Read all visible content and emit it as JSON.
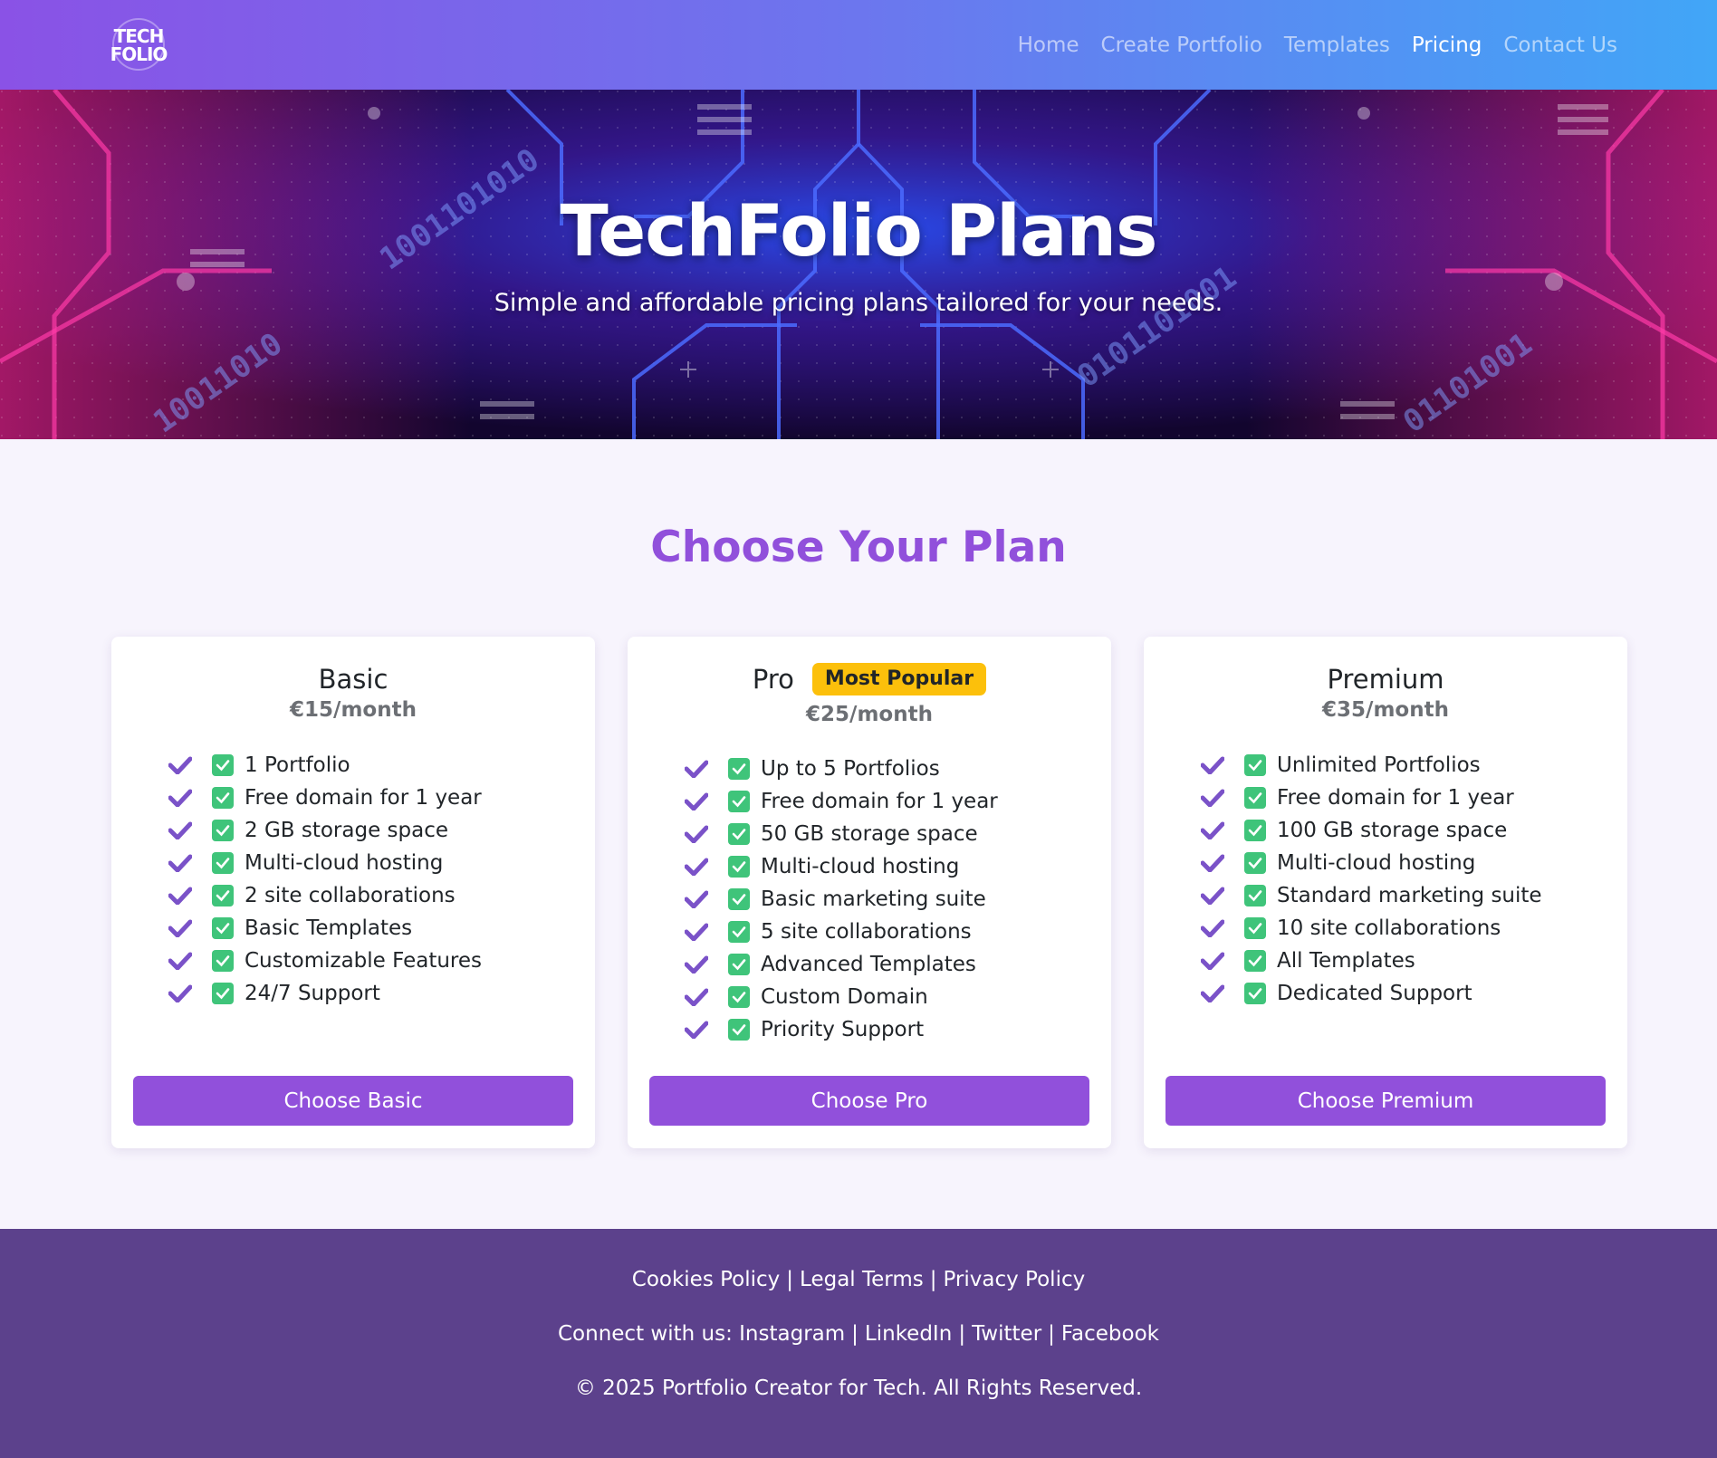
{
  "brand": {
    "logo_line1": "TECH",
    "logo_line2": "FOLIO",
    "gradient_start": "#8a52e6",
    "gradient_end": "#41a6f7"
  },
  "nav": {
    "items": [
      {
        "label": "Home",
        "active": false
      },
      {
        "label": "Create Portfolio",
        "active": false
      },
      {
        "label": "Templates",
        "active": false
      },
      {
        "label": "Pricing",
        "active": true
      },
      {
        "label": "Contact Us",
        "active": false
      }
    ]
  },
  "hero": {
    "title": "TechFolio Plans",
    "subtitle": "Simple and affordable pricing plans tailored for your needs."
  },
  "plans_section": {
    "title": "Choose Your Plan",
    "accent_color": "#9150db",
    "check_color": "#3fc47a",
    "badge_color": "#fcc00b"
  },
  "plans": [
    {
      "name": "Basic",
      "price": "€15/month",
      "badge": "",
      "features": [
        "1 Portfolio",
        "Free domain for 1 year",
        "2 GB storage space",
        "Multi-cloud hosting",
        "2 site collaborations",
        "Basic Templates",
        "Customizable Features",
        "24/7 Support"
      ],
      "button": "Choose Basic"
    },
    {
      "name": "Pro",
      "price": "€25/month",
      "badge": "Most Popular",
      "features": [
        "Up to 5 Portfolios",
        "Free domain for 1 year",
        "50 GB storage space",
        "Multi-cloud hosting",
        "Basic marketing suite",
        "5 site collaborations",
        "Advanced Templates",
        "Custom Domain",
        "Priority Support"
      ],
      "button": "Choose Pro"
    },
    {
      "name": "Premium",
      "price": "€35/month",
      "badge": "",
      "features": [
        "Unlimited Portfolios",
        "Free domain for 1 year",
        "100 GB storage space",
        "Multi-cloud hosting",
        "Standard marketing suite",
        "10 site collaborations",
        "All Templates",
        "Dedicated Support"
      ],
      "button": "Choose Premium"
    }
  ],
  "footer": {
    "policy_links": [
      "Cookies Policy",
      "Legal Terms",
      "Privacy Policy"
    ],
    "connect_label": "Connect with us:",
    "social_links": [
      "Instagram",
      "LinkedIn",
      "Twitter",
      "Facebook"
    ],
    "copyright": "© 2025 Portfolio Creator for Tech. All Rights Reserved.",
    "background": "#5c418c"
  }
}
